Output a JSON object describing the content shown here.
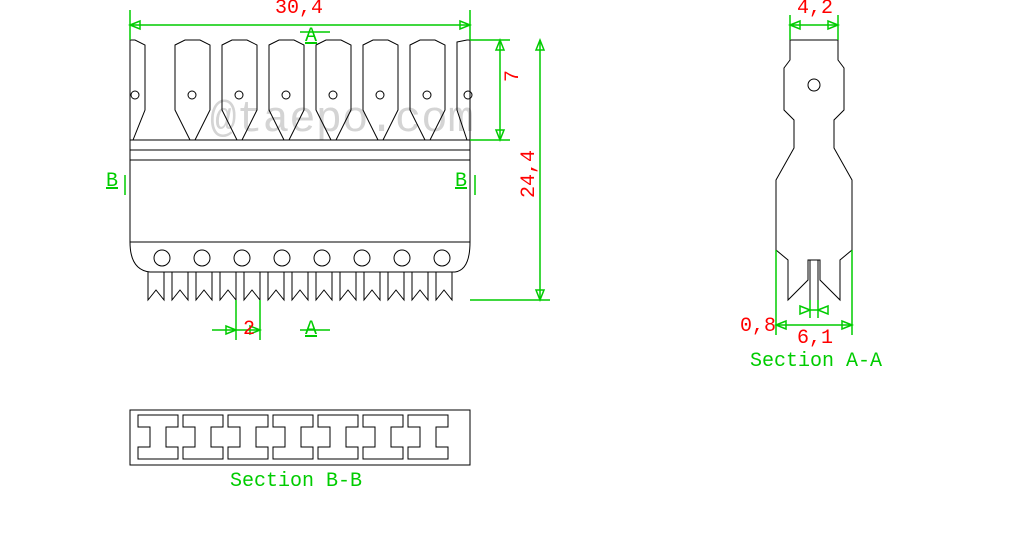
{
  "dimensions": {
    "width_overall": "30,4",
    "height_top_teeth": "7",
    "height_overall": "24,4",
    "pitch_bottom": "2",
    "section_aa_top_width": "4,2",
    "section_aa_bottom_width": "6,1",
    "section_aa_wall": "0,8"
  },
  "section_markers": {
    "a_top": "A",
    "a_bottom": "A",
    "b_left": "B",
    "b_right": "B"
  },
  "labels": {
    "section_bb": "Section B-B",
    "section_aa": "Section A-A"
  },
  "watermark": "@taepo.com"
}
